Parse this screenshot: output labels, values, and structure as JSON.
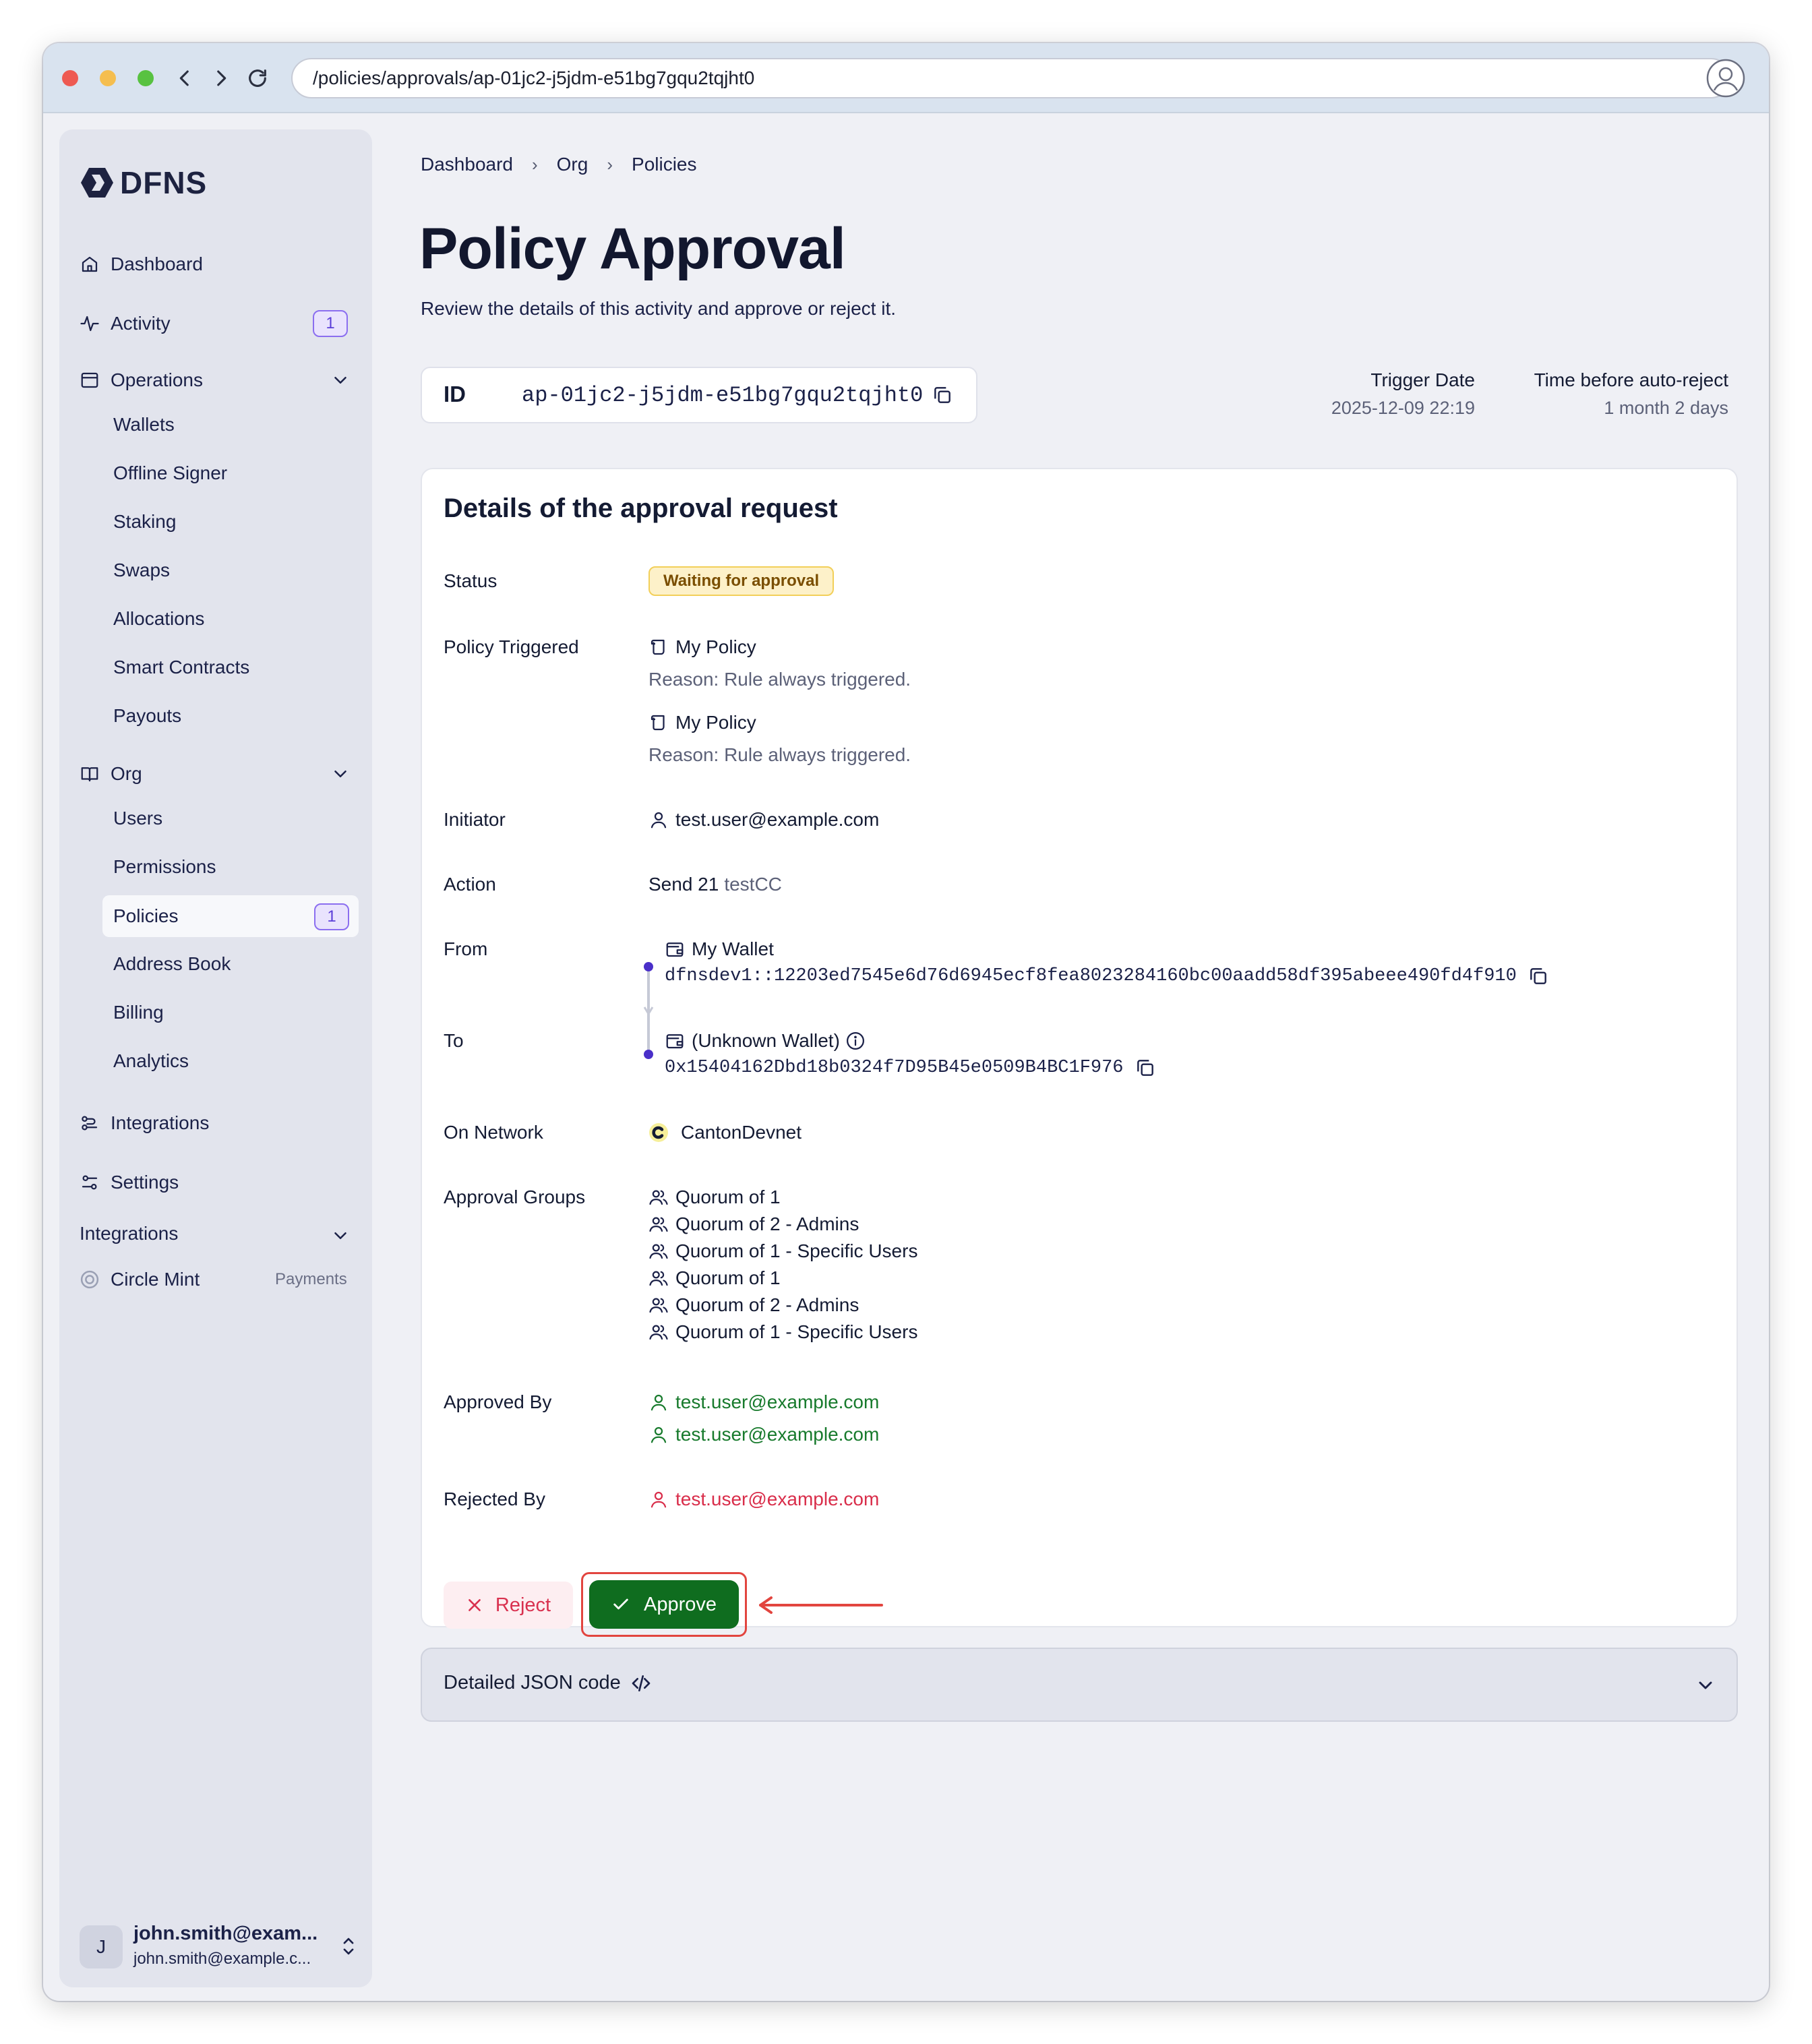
{
  "browser": {
    "url": "/policies/approvals/ap-01jc2-j5jdm-e51bg7gqu2tqjht0"
  },
  "sidebar": {
    "logo": "DFNS",
    "nav": {
      "dashboard": "Dashboard",
      "activity": "Activity",
      "activity_badge": "1",
      "operations": "Operations",
      "org": "Org",
      "integrations": "Integrations",
      "settings": "Settings"
    },
    "operations_items": [
      "Wallets",
      "Offline Signer",
      "Staking",
      "Swaps",
      "Allocations",
      "Smart Contracts",
      "Payouts"
    ],
    "org_items": [
      "Users",
      "Permissions",
      "Policies",
      "Address Book",
      "Billing",
      "Analytics"
    ],
    "policies_badge": "1",
    "integrations_section": "Integrations",
    "circle_mint": "Circle Mint",
    "circle_mint_tag": "Payments",
    "user": {
      "initial": "J",
      "name": "john.smith@exam...",
      "email": "john.smith@example.c..."
    }
  },
  "breadcrumb": [
    "Dashboard",
    "Org",
    "Policies"
  ],
  "page": {
    "title": "Policy Approval",
    "subtitle": "Review the details of this activity and approve or reject it."
  },
  "approval": {
    "id_label": "ID",
    "id": "ap-01jc2-j5jdm-e51bg7gqu2tqjht0",
    "trigger_date_label": "Trigger Date",
    "trigger_date": "2025-12-09 22:19",
    "auto_reject_label": "Time before auto-reject",
    "auto_reject": "1 month 2 days"
  },
  "details": {
    "title": "Details of the approval request",
    "labels": {
      "status": "Status",
      "policy": "Policy Triggered",
      "initiator": "Initiator",
      "action": "Action",
      "from": "From",
      "to": "To",
      "network": "On Network",
      "groups": "Approval Groups",
      "approved_by": "Approved By",
      "rejected_by": "Rejected By"
    },
    "status": "Waiting for approval",
    "policies": [
      {
        "name": "My Policy",
        "reason": "Reason: Rule always triggered."
      },
      {
        "name": "My Policy",
        "reason": "Reason: Rule always triggered."
      }
    ],
    "initiator": "test.user@example.com",
    "action_text": "Send 21",
    "action_asset": "testCC",
    "from_name": "My Wallet",
    "from_address": "dfnsdev1::12203ed7545e6d76d6945ecf8fea8023284160bc00aadd58df395abeee490fd4f910",
    "to_name": "(Unknown Wallet)",
    "to_address": "0x15404162Dbd18b0324f7D95B45e0509B4BC1F976",
    "network": "CantonDevnet",
    "groups": [
      "Quorum of 1",
      "Quorum of 2 - Admins",
      "Quorum of 1 - Specific Users",
      "Quorum of 1",
      "Quorum of 2 - Admins",
      "Quorum of 1 - Specific Users"
    ],
    "approved_by": [
      "test.user@example.com",
      "test.user@example.com"
    ],
    "rejected_by": "test.user@example.com",
    "reject_label": "Reject",
    "approve_label": "Approve"
  },
  "json_section": {
    "label": "Detailed JSON code"
  }
}
